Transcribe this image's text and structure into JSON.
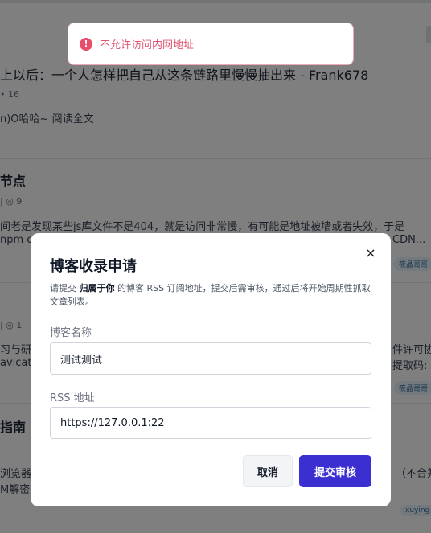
{
  "background": {
    "article1": {
      "title": "上以后：一个人怎样把自己从这条链路里慢慢抽出来 - Frank678",
      "meta": "• 16",
      "excerpt": "n)O哈哈~ 阅读全文"
    },
    "article2": {
      "title": "节点",
      "meta": "| ◎ 9",
      "excerpt1": "间老是发现某些js库文件不是404，就是访问非常慢，有可能是地址被墙或者失效，于是",
      "excerpt2": "npm c",
      "excerpt2_right": "CDN...",
      "tag": "筱晶哥哥"
    },
    "article3": {
      "meta": "| ◎ 1",
      "excerpt1": "习与研",
      "excerpt1_right": "件许可协",
      "excerpt2": "avicat1",
      "excerpt2_right": "提取码: df",
      "tag": "筱晶哥哥"
    },
    "article4": {
      "title": "指南",
      "excerpt1": "浏览器",
      "excerpt1_right": "（不合并",
      "excerpt2": "M解密后",
      "tag": "xuying"
    }
  },
  "toast": {
    "icon": "exclamation-icon",
    "message": "不允许访问内网地址",
    "color": "#e25470"
  },
  "modal": {
    "title": "博客收录申请",
    "desc_prefix": "请提交 ",
    "desc_bold": "归属于你",
    "desc_suffix": " 的博客 RSS 订阅地址，提交后需审核，通过后将开始周期性抓取文章列表。",
    "close_icon": "×",
    "name_label": "博客名称",
    "name_value": "测试测试",
    "rss_label": "RSS 地址",
    "rss_value": "https://127.0.0.1:22",
    "cancel_label": "取消",
    "submit_label": "提交审核",
    "accent": "#3b2fd1"
  }
}
